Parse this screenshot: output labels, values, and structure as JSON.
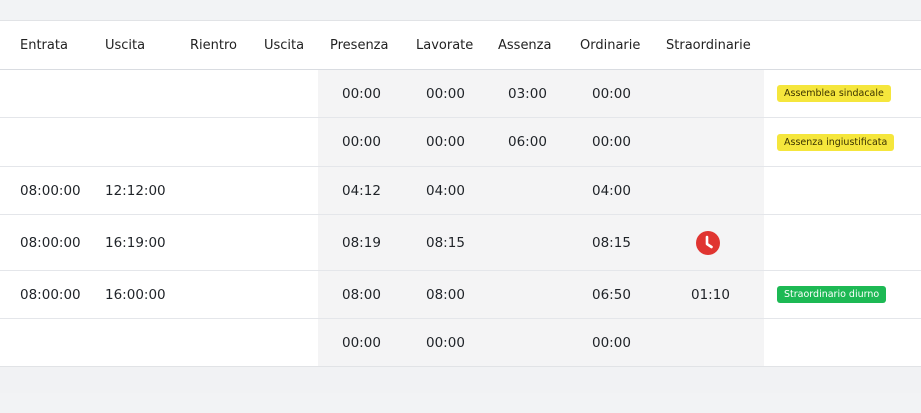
{
  "columns": {
    "entrata": "Entrata",
    "uscita": "Uscita",
    "rientro": "Rientro",
    "uscita2": "Uscita",
    "presenza": "Presenza",
    "lavorate": "Lavorate",
    "assenza": "Assenza",
    "ordinarie": "Ordinarie",
    "straordinarie": "Straordinarie"
  },
  "rows": [
    {
      "entrata": "",
      "uscita": "",
      "rientro": "",
      "uscita2": "",
      "presenza": "00:00",
      "lavorate": "00:00",
      "assenza": "03:00",
      "ordinarie": "00:00",
      "straordinarie": "",
      "badge": "Assemblea sindacale",
      "badge_color": "#f5e63c"
    },
    {
      "entrata": "",
      "uscita": "",
      "rientro": "",
      "uscita2": "",
      "presenza": "00:00",
      "lavorate": "00:00",
      "assenza": "06:00",
      "ordinarie": "00:00",
      "straordinarie": "",
      "badge": "Assenza ingiustificata",
      "badge_color": "#f5e63c"
    },
    {
      "entrata": "08:00:00",
      "uscita": "12:12:00",
      "rientro": "",
      "uscita2": "",
      "presenza": "04:12",
      "lavorate": "04:00",
      "assenza": "",
      "ordinarie": "04:00",
      "straordinarie": "",
      "badge": ""
    },
    {
      "entrata": "08:00:00",
      "uscita": "16:19:00",
      "rientro": "",
      "uscita2": "",
      "presenza": "08:19",
      "lavorate": "08:15",
      "assenza": "",
      "ordinarie": "08:15",
      "straordinarie": "",
      "badge": "",
      "icon": "clock-icon"
    },
    {
      "entrata": "08:00:00",
      "uscita": "16:00:00",
      "rientro": "",
      "uscita2": "",
      "presenza": "08:00",
      "lavorate": "08:00",
      "assenza": "",
      "ordinarie": "06:50",
      "straordinarie": "01:10",
      "badge": "Straordinario diurno",
      "badge_color": "#1db954"
    },
    {
      "entrata": "",
      "uscita": "",
      "rientro": "",
      "uscita2": "",
      "presenza": "00:00",
      "lavorate": "00:00",
      "assenza": "",
      "ordinarie": "00:00",
      "straordinarie": "",
      "badge": ""
    }
  ],
  "colors": {
    "badge_yellow": "#f5e63c",
    "badge_green": "#1db954",
    "clock_icon": "#e03531"
  }
}
